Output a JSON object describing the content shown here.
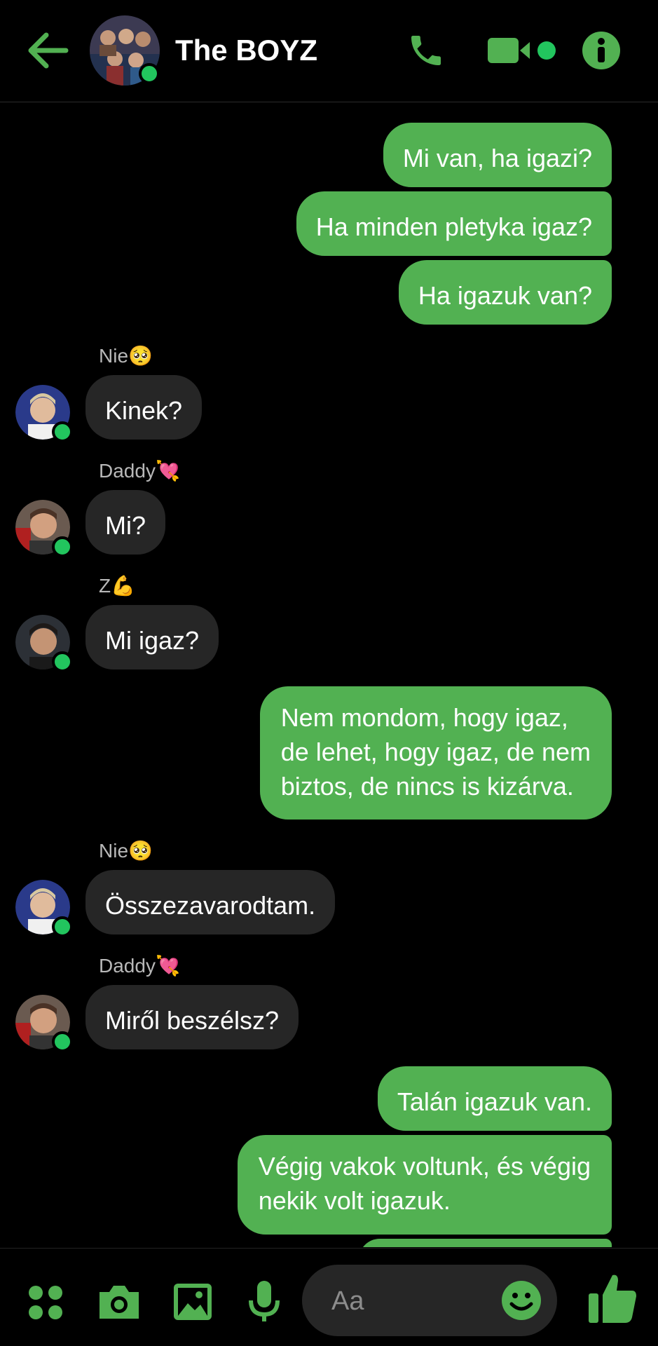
{
  "header": {
    "title": "The BOYZ",
    "back_icon": "arrow-left-icon",
    "call_icon": "phone-icon",
    "video_icon": "video-camera-icon",
    "info_icon": "info-icon"
  },
  "colors": {
    "accent": "#52b152",
    "online": "#22c55e",
    "incoming_bubble": "#262626",
    "background": "#000000"
  },
  "messages": [
    {
      "direction": "out",
      "text": "Mi van, ha igazi?"
    },
    {
      "direction": "out",
      "text": "Ha minden pletyka igaz?"
    },
    {
      "direction": "out",
      "text": "Ha igazuk van?"
    },
    {
      "direction": "in",
      "sender": "Nie🥺",
      "text": "Kinek?"
    },
    {
      "direction": "in",
      "sender": "Daddy💘",
      "text": "Mi?"
    },
    {
      "direction": "in",
      "sender": "Z💪",
      "text": "Mi igaz?"
    },
    {
      "direction": "out",
      "lines": [
        "Nem mondom, hogy igaz,",
        "de lehet, hogy igaz, de nem",
        "biztos, de nincs is kizárva."
      ]
    },
    {
      "direction": "in",
      "sender": "Nie🥺",
      "text": "Összezavarodtam."
    },
    {
      "direction": "in",
      "sender": "Daddy💘",
      "text": "Miről beszélsz?"
    },
    {
      "direction": "out",
      "text": "Talán igazuk van."
    },
    {
      "direction": "out",
      "lines": [
        "Végig vakok voltunk, és végig",
        "nekik volt igazuk."
      ]
    }
  ],
  "composer": {
    "placeholder": "Aa",
    "icons": [
      "grid-menu-icon",
      "camera-icon",
      "image-icon",
      "microphone-icon",
      "emoji-icon",
      "thumbs-up-icon"
    ]
  }
}
